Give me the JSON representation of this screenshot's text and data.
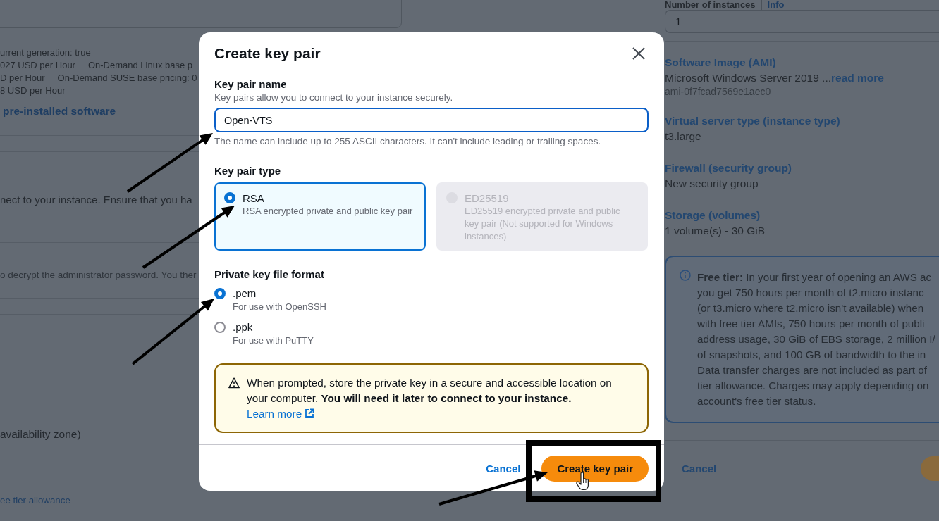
{
  "background_page": {
    "left_column": {
      "pricing_lines": [
        [
          "urrent generation: true"
        ],
        [
          "027 USD per Hour",
          "On-Demand Linux base p"
        ],
        [
          "D per Hour",
          "On-Demand SUSE base pricing: 0"
        ],
        [
          "8 USD per Hour"
        ]
      ],
      "software_link": "pre-installed software",
      "key_pair_note": "nect to your instance. Ensure that you ha",
      "password_note": "o decrypt the administrator password. You ther",
      "subnet_note": "availability zone)",
      "free_tier_link": "ee tier allowance"
    },
    "summary": {
      "instances": {
        "label": "Number of instances",
        "info": "Info",
        "value": "1"
      },
      "sections": [
        {
          "title": "Software Image (AMI)",
          "value": "Microsoft Windows Server 2019 ...",
          "link": "read more",
          "detail": "ami-0f7fcad7569e1aec0"
        },
        {
          "title": "Virtual server type (instance type)",
          "value": "t3.large"
        },
        {
          "title": "Firewall (security group)",
          "value": "New security group"
        },
        {
          "title": "Storage (volumes)",
          "value": "1 volume(s) - 30 GiB"
        }
      ],
      "free_tier": {
        "lines": [
          "**Free tier:** In your first year of opening an AWS ac",
          "you get 750 hours per month of t2.micro instanc",
          "(or t3.micro where t2.micro isn't available) when",
          "with free tier AMIs, 750 hours per month of publi",
          "address usage, 30 GiB of EBS storage, 2 million I/",
          "of snapshots, and 100 GB of bandwidth to the in",
          "Data transfer charges are not included as part of",
          "tier allowance. Charges may apply depending on",
          "account's free tier status."
        ]
      },
      "cancel": "Cancel"
    }
  },
  "dialog": {
    "title": "Create key pair",
    "name_field": {
      "label": "Key pair name",
      "description": "Key pairs allow you to connect to your instance securely.",
      "value": "Open-VTS",
      "focused": true,
      "constraint": "The name can include up to 255 ASCII characters. It can't include leading or trailing spaces."
    },
    "key_pair_type": {
      "label": "Key pair type",
      "options": [
        {
          "title": "RSA",
          "description": "RSA encrypted private and public key pair",
          "selected": true,
          "disabled": false
        },
        {
          "title": "ED25519",
          "description": "ED25519 encrypted private and public key pair (Not supported for Windows instances)",
          "selected": false,
          "disabled": true
        }
      ]
    },
    "file_format": {
      "label": "Private key file format",
      "options": [
        {
          "title": ".pem",
          "description": "For use with OpenSSH",
          "selected": true
        },
        {
          "title": ".ppk",
          "description": "For use with PuTTY",
          "selected": false
        }
      ]
    },
    "warning": {
      "message": "When prompted, store the private key in a secure and accessible location on your computer. **You will need it later to connect to your instance.**",
      "link": "Learn more"
    },
    "buttons": [
      {
        "label": "Cancel",
        "kind": "link"
      },
      {
        "label": "Create key pair",
        "kind": "primary"
      }
    ]
  },
  "pointer": {
    "kind": "hand"
  },
  "annotations": [
    {
      "kind": "arrow"
    },
    {
      "kind": "arrow"
    },
    {
      "kind": "arrow"
    },
    {
      "kind": "arrow"
    },
    {
      "kind": "frame"
    }
  ]
}
